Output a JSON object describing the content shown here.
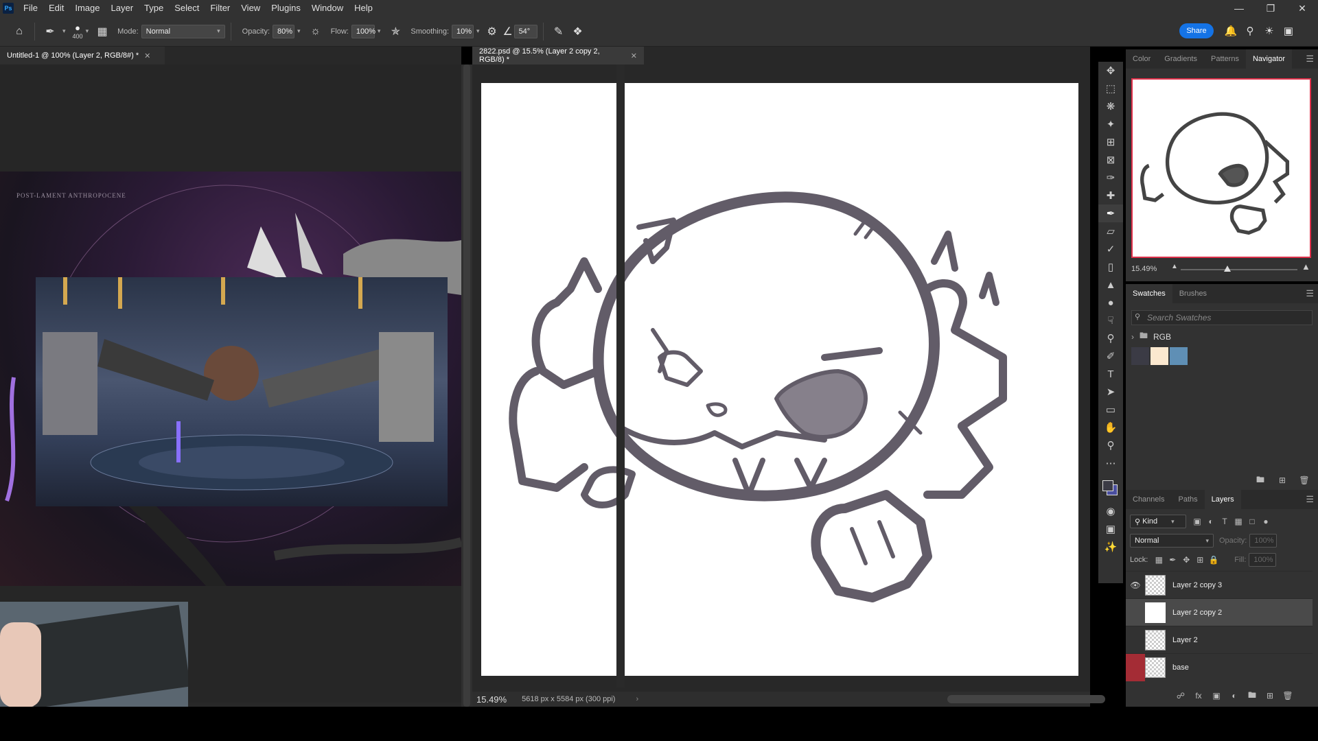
{
  "menu": {
    "logo": "Ps",
    "items": [
      "File",
      "Edit",
      "Image",
      "Layer",
      "Type",
      "Select",
      "Filter",
      "View",
      "Plugins",
      "Window",
      "Help"
    ]
  },
  "options": {
    "brush_size": "400",
    "mode_label": "Mode:",
    "mode_value": "Normal",
    "opacity_label": "Opacity:",
    "opacity_value": "80%",
    "flow_label": "Flow:",
    "flow_value": "100%",
    "smoothing_label": "Smoothing:",
    "smoothing_value": "10%",
    "angle_value": "54°",
    "share_label": "Share"
  },
  "docs": {
    "left_tab": "Untitled-1 @ 100% (Layer 2, RGB/8#) *",
    "right_tab": "2822.psd @ 15.5% (Layer 2 copy 2, RGB/8) *",
    "zoom": "15.49%",
    "doc_info": "5618 px x 5584 px (300 ppi)",
    "poster_caption": "POST-LAMENT ANTHROPOCENE"
  },
  "panels": {
    "top_tabs": [
      "Color",
      "Gradients",
      "Patterns",
      "Navigator"
    ],
    "top_active": "Navigator",
    "nav_zoom": "15.49%",
    "mid_tabs": [
      "Swatches",
      "Brushes"
    ],
    "search_placeholder": "Search Swatches",
    "swatch_folder": "RGB",
    "swatches": [
      "#3b3b45",
      "#fbe8cf",
      "#5f8fb5"
    ],
    "layer_tabs": [
      "Channels",
      "Paths",
      "Layers"
    ],
    "layer_active": "Layers",
    "kind_label": "Kind",
    "blend_mode": "Normal",
    "opacity_label": "Opacity:",
    "opacity_value": "100%",
    "lock_label": "Lock:",
    "fill_label": "Fill:",
    "fill_value": "100%",
    "layers": [
      {
        "name": "Layer 2 copy 3",
        "visible": true,
        "selected": false
      },
      {
        "name": "Layer 2 copy 2",
        "visible": false,
        "selected": true
      },
      {
        "name": "Layer 2",
        "visible": false,
        "selected": false
      },
      {
        "name": "base",
        "visible": false,
        "selected": false
      }
    ]
  },
  "colors": {
    "accent": "#1473e6",
    "nav_border": "#e0304a",
    "base_layer_swatch": "#a42c35"
  }
}
